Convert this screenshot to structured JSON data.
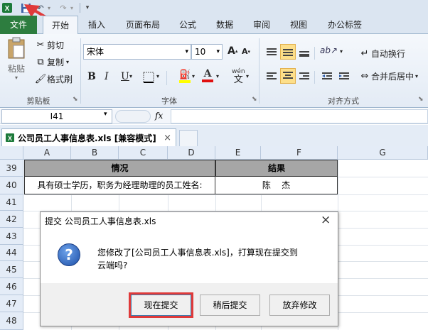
{
  "qat": {
    "undo": "↶",
    "redo": "↷"
  },
  "tabs": [
    "文件",
    "开始",
    "插入",
    "页面布局",
    "公式",
    "数据",
    "审阅",
    "视图",
    "办公标签"
  ],
  "clipboard": {
    "paste": "粘贴",
    "cut": "剪切",
    "copy": "复制",
    "format_painter": "格式刷",
    "group": "剪贴板"
  },
  "font": {
    "name": "宋体",
    "size": "10",
    "group": "字体",
    "bold": "B",
    "italic": "I",
    "underline": "U",
    "font_color_letter": "A",
    "wen": "wén"
  },
  "align": {
    "wrap": "自动换行",
    "merge": "合并后居中",
    "group": "对齐方式"
  },
  "formula_bar": {
    "name_box": "I41",
    "fx": "fx",
    "value": ""
  },
  "workbook_tab": {
    "title": "公司员工人事信息表.xls [兼容模式]",
    "close": "×"
  },
  "columns": [
    "A",
    "B",
    "C",
    "D",
    "E",
    "F",
    "G"
  ],
  "rows": [
    "39",
    "40",
    "41",
    "42",
    "43",
    "44",
    "45",
    "46",
    "47",
    "48"
  ],
  "cells": {
    "r39_situation": "情况",
    "r39_result": "结果",
    "r40_question": "具有硕士学历，职务为经理助理的员工姓名:",
    "r40_answer": "陈    杰"
  },
  "dialog": {
    "title": "提交 公司员工人事信息表.xls",
    "close": "×",
    "icon": "?",
    "message_line1": "您修改了[公司员工人事信息表.xls]，打算现在提交到",
    "message_line2": "云端吗?",
    "btn_submit_now": "现在提交",
    "btn_submit_later": "稍后提交",
    "btn_discard": "放弃修改"
  },
  "colors": {
    "file_tab": "#2d7d3f",
    "highlight_red": "#e03a3a",
    "header_dark": "#a6a6a6"
  }
}
